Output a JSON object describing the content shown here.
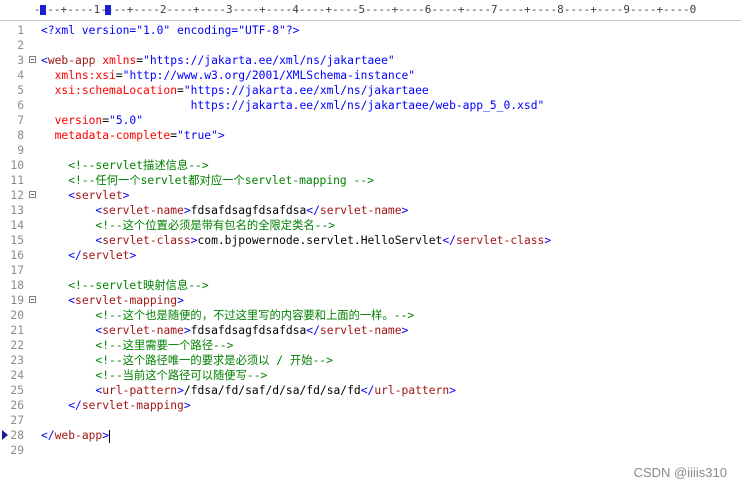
{
  "ruler": {
    "text": "----+----1----+----2----+----3----+----4----+----5----+----6----+----7----+----8----+----9----+----0"
  },
  "lines": [
    {
      "num": "1",
      "fold": false,
      "parts": [
        [
          "pi",
          "<?xml version=\"1.0\" encoding=\"UTF-8\"?>"
        ]
      ]
    },
    {
      "num": "2",
      "fold": false,
      "parts": []
    },
    {
      "num": "3",
      "fold": true,
      "parts": [
        [
          "tag",
          "<"
        ],
        [
          "name",
          "web-app"
        ],
        [
          "text",
          " "
        ],
        [
          "attr",
          "xmlns"
        ],
        [
          "text",
          "="
        ],
        [
          "val",
          "\"https://jakarta.ee/xml/ns/jakartaee\""
        ]
      ]
    },
    {
      "num": "4",
      "fold": false,
      "parts": [
        [
          "text",
          "  "
        ],
        [
          "attr",
          "xmlns:xsi"
        ],
        [
          "text",
          "="
        ],
        [
          "val",
          "\"http://www.w3.org/2001/XMLSchema-instance\""
        ]
      ]
    },
    {
      "num": "5",
      "fold": false,
      "parts": [
        [
          "text",
          "  "
        ],
        [
          "attr",
          "xsi:schemaLocation"
        ],
        [
          "text",
          "="
        ],
        [
          "val",
          "\"https://jakarta.ee/xml/ns/jakartaee"
        ]
      ]
    },
    {
      "num": "6",
      "fold": false,
      "parts": [
        [
          "val",
          "                      https://jakarta.ee/xml/ns/jakartaee/web-app_5_0.xsd\""
        ]
      ]
    },
    {
      "num": "7",
      "fold": false,
      "parts": [
        [
          "text",
          "  "
        ],
        [
          "attr",
          "version"
        ],
        [
          "text",
          "="
        ],
        [
          "val",
          "\"5.0\""
        ]
      ]
    },
    {
      "num": "8",
      "fold": false,
      "parts": [
        [
          "text",
          "  "
        ],
        [
          "attr",
          "metadata-complete"
        ],
        [
          "text",
          "="
        ],
        [
          "val",
          "\"true\""
        ],
        [
          "tag",
          ">"
        ]
      ]
    },
    {
      "num": "9",
      "fold": false,
      "parts": []
    },
    {
      "num": "10",
      "fold": false,
      "parts": [
        [
          "text",
          "    "
        ],
        [
          "cmt",
          "<!--servlet描述信息-->"
        ]
      ]
    },
    {
      "num": "11",
      "fold": false,
      "parts": [
        [
          "text",
          "    "
        ],
        [
          "cmt",
          "<!--任何一个servlet都对应一个servlet-mapping -->"
        ]
      ]
    },
    {
      "num": "12",
      "fold": true,
      "parts": [
        [
          "text",
          "    "
        ],
        [
          "tag",
          "<"
        ],
        [
          "name",
          "servlet"
        ],
        [
          "tag",
          ">"
        ]
      ]
    },
    {
      "num": "13",
      "fold": false,
      "parts": [
        [
          "text",
          "        "
        ],
        [
          "tag",
          "<"
        ],
        [
          "name",
          "servlet-name"
        ],
        [
          "tag",
          ">"
        ],
        [
          "text",
          "fdsafdsagfdsafdsa"
        ],
        [
          "tag",
          "</"
        ],
        [
          "name",
          "servlet-name"
        ],
        [
          "tag",
          ">"
        ]
      ]
    },
    {
      "num": "14",
      "fold": false,
      "parts": [
        [
          "text",
          "        "
        ],
        [
          "cmt",
          "<!--这个位置必须是带有包名的全限定类名-->"
        ]
      ]
    },
    {
      "num": "15",
      "fold": false,
      "parts": [
        [
          "text",
          "        "
        ],
        [
          "tag",
          "<"
        ],
        [
          "name",
          "servlet-class"
        ],
        [
          "tag",
          ">"
        ],
        [
          "text",
          "com.bjpowernode.servlet.HelloServlet"
        ],
        [
          "tag",
          "</"
        ],
        [
          "name",
          "servlet-class"
        ],
        [
          "tag",
          ">"
        ]
      ]
    },
    {
      "num": "16",
      "fold": false,
      "parts": [
        [
          "text",
          "    "
        ],
        [
          "tag",
          "</"
        ],
        [
          "name",
          "servlet"
        ],
        [
          "tag",
          ">"
        ]
      ]
    },
    {
      "num": "17",
      "fold": false,
      "parts": []
    },
    {
      "num": "18",
      "fold": false,
      "parts": [
        [
          "text",
          "    "
        ],
        [
          "cmt",
          "<!--servlet映射信息-->"
        ]
      ]
    },
    {
      "num": "19",
      "fold": true,
      "parts": [
        [
          "text",
          "    "
        ],
        [
          "tag",
          "<"
        ],
        [
          "name",
          "servlet-mapping"
        ],
        [
          "tag",
          ">"
        ]
      ]
    },
    {
      "num": "20",
      "fold": false,
      "parts": [
        [
          "text",
          "        "
        ],
        [
          "cmt",
          "<!--这个也是随便的，不过这里写的内容要和上面的一样。-->"
        ]
      ]
    },
    {
      "num": "21",
      "fold": false,
      "parts": [
        [
          "text",
          "        "
        ],
        [
          "tag",
          "<"
        ],
        [
          "name",
          "servlet-name"
        ],
        [
          "tag",
          ">"
        ],
        [
          "text",
          "fdsafdsagfdsafdsa"
        ],
        [
          "tag",
          "</"
        ],
        [
          "name",
          "servlet-name"
        ],
        [
          "tag",
          ">"
        ]
      ]
    },
    {
      "num": "22",
      "fold": false,
      "parts": [
        [
          "text",
          "        "
        ],
        [
          "cmt",
          "<!--这里需要一个路径-->"
        ]
      ]
    },
    {
      "num": "23",
      "fold": false,
      "parts": [
        [
          "text",
          "        "
        ],
        [
          "cmt",
          "<!--这个路径唯一的要求是必须以 / 开始-->"
        ]
      ]
    },
    {
      "num": "24",
      "fold": false,
      "parts": [
        [
          "text",
          "        "
        ],
        [
          "cmt",
          "<!--当前这个路径可以随便写-->"
        ]
      ]
    },
    {
      "num": "25",
      "fold": false,
      "parts": [
        [
          "text",
          "        "
        ],
        [
          "tag",
          "<"
        ],
        [
          "name",
          "url-pattern"
        ],
        [
          "tag",
          ">"
        ],
        [
          "text",
          "/fdsa/fd/saf/d/sa/fd/sa/fd"
        ],
        [
          "tag",
          "</"
        ],
        [
          "name",
          "url-pattern"
        ],
        [
          "tag",
          ">"
        ]
      ]
    },
    {
      "num": "26",
      "fold": false,
      "parts": [
        [
          "text",
          "    "
        ],
        [
          "tag",
          "</"
        ],
        [
          "name",
          "servlet-mapping"
        ],
        [
          "tag",
          ">"
        ]
      ]
    },
    {
      "num": "27",
      "fold": false,
      "parts": []
    },
    {
      "num": "28",
      "fold": false,
      "bookmark": true,
      "cursor": true,
      "parts": [
        [
          "tag",
          "</"
        ],
        [
          "name",
          "web-app"
        ],
        [
          "tag",
          ">"
        ]
      ]
    },
    {
      "num": "29",
      "fold": false,
      "parts": []
    }
  ],
  "watermark": "CSDN @iiiis310"
}
